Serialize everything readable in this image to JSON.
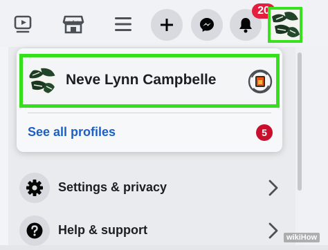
{
  "topbar": {
    "icons": [
      "watch-icon",
      "marketplace-icon",
      "menu-icon"
    ],
    "actions": [
      "create-icon",
      "messenger-icon",
      "notifications-icon"
    ],
    "notification_count": "20"
  },
  "profile_switcher": {
    "profile_name": "Neve Lynn Campbelle",
    "see_all_label": "See all profiles",
    "profiles_count": "5"
  },
  "menu": {
    "items": [
      {
        "label": "Settings & privacy",
        "icon": "gear-icon"
      },
      {
        "label": "Help & support",
        "icon": "question-icon"
      }
    ]
  },
  "watermark": "wikiHow",
  "colors": {
    "highlight": "#35df1b",
    "link": "#1b5fc9",
    "badge": "#e41e3f"
  }
}
